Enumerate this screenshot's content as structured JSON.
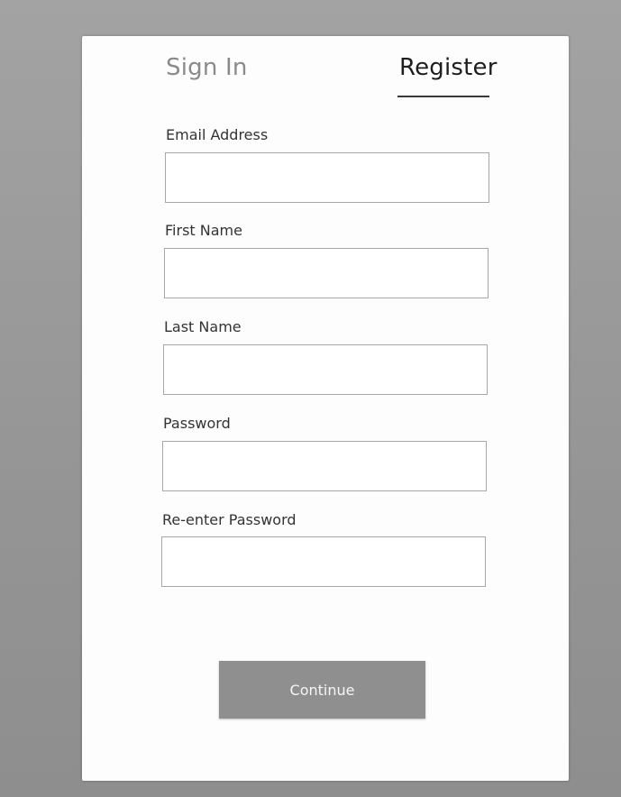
{
  "tabs": {
    "sign_in": "Sign In",
    "register": "Register",
    "active": "Register"
  },
  "form": {
    "email_label": "Email Address",
    "email_value": "",
    "first_name_label": "First Name",
    "first_name_value": "",
    "last_name_label": "Last Name",
    "last_name_value": "",
    "password_label": "Password",
    "password_value": "",
    "reenter_password_label": "Re-enter Password",
    "reenter_password_value": ""
  },
  "actions": {
    "continue_label": "Continue"
  },
  "colors": {
    "background": "#9a9a9a",
    "card": "#fdfdfd",
    "button": "#8f8f8f",
    "active_tab_text": "#1e1e1e",
    "inactive_tab_text": "#8a8a8a"
  }
}
